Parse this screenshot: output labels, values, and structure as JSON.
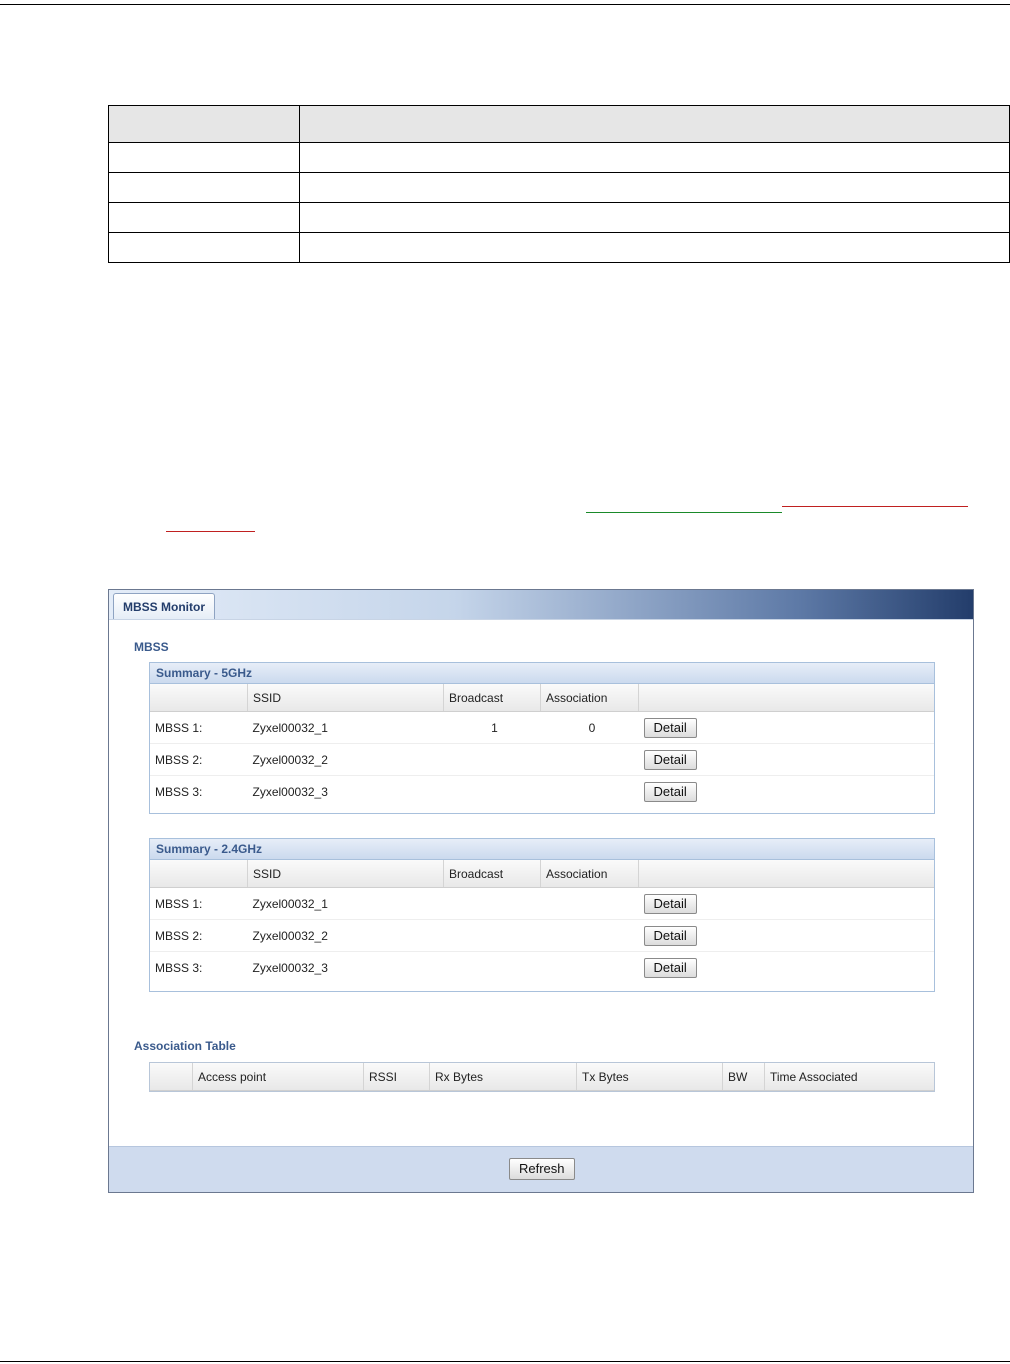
{
  "mbss_monitor": {
    "tab_label": "MBSS Monitor",
    "section_mbss": "MBSS",
    "summary_5ghz": {
      "title": "Summary - 5GHz",
      "columns": [
        "",
        "SSID",
        "Broadcast",
        "Association",
        ""
      ],
      "rows": [
        {
          "label": "MBSS 1:",
          "ssid": "Zyxel00032_1",
          "broadcast": "1",
          "association": "0",
          "button": "Detail"
        },
        {
          "label": "MBSS 2:",
          "ssid": "Zyxel00032_2",
          "broadcast": "",
          "association": "",
          "button": "Detail"
        },
        {
          "label": "MBSS 3:",
          "ssid": "Zyxel00032_3",
          "broadcast": "",
          "association": "",
          "button": "Detail"
        }
      ]
    },
    "summary_24ghz": {
      "title": "Summary - 2.4GHz",
      "columns": [
        "",
        "SSID",
        "Broadcast",
        "Association",
        ""
      ],
      "rows": [
        {
          "label": "MBSS 1:",
          "ssid": "Zyxel00032_1",
          "broadcast": "",
          "association": "",
          "button": "Detail"
        },
        {
          "label": "MBSS 2:",
          "ssid": "Zyxel00032_2",
          "broadcast": "",
          "association": "",
          "button": "Detail"
        },
        {
          "label": "MBSS 3:",
          "ssid": "Zyxel00032_3",
          "broadcast": "",
          "association": "",
          "button": "Detail"
        }
      ]
    },
    "association_table": {
      "title": "Association Table",
      "columns": [
        "",
        "Access point",
        "RSSI",
        "Rx Bytes",
        "Tx Bytes",
        "BW",
        "Time Associated"
      ]
    },
    "refresh_label": "Refresh"
  }
}
